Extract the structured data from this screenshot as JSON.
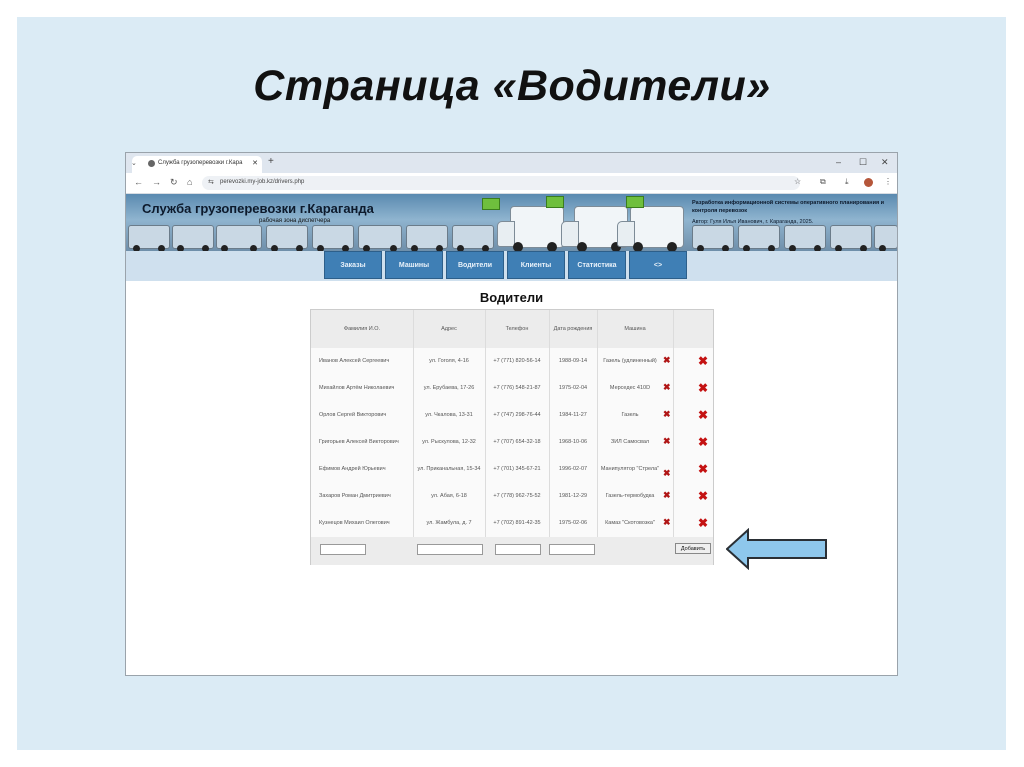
{
  "slide": {
    "title": "Страница «Водители»"
  },
  "browser": {
    "tab_title": "Служба грузоперевозки г.Кара",
    "url": "perevozki.my-job.kz/drivers.php"
  },
  "header": {
    "site_title": "Служба грузоперевозки г.Караганда",
    "subtitle": "рабочая зона диспетчера",
    "dev_info": "Разработка информационной системы оперативного планирования и контроля перевозок",
    "author": "Автор: Гуля Илья Иванович, г. Караганда, 2025."
  },
  "nav": {
    "items": [
      "Заказы",
      "Машины",
      "Водители",
      "Клиенты",
      "Статистика",
      "<>"
    ]
  },
  "page": {
    "heading": "Водители"
  },
  "table": {
    "headers": [
      "Фамилия И.О.",
      "Адрес",
      "Телефон",
      "Дата рождения",
      "Машина"
    ],
    "rows": [
      {
        "name": "Иванов Алексей Сергеевич",
        "address": "ул. Гоголя, 4-16",
        "phone": "+7 (771) 820-56-14",
        "birth": "1988-09-14",
        "car": "Газель (удлиненный)"
      },
      {
        "name": "Михайлов Артём Николаевич",
        "address": "ул. Ерубаева, 17-26",
        "phone": "+7 (776) 548-21-87",
        "birth": "1975-02-04",
        "car": "Мерседес 410D"
      },
      {
        "name": "Орлов Сергей Викторович",
        "address": "ул. Чкалова, 13-31",
        "phone": "+7 (747) 298-76-44",
        "birth": "1984-11-27",
        "car": "Газель"
      },
      {
        "name": "Григорьев Алексей Викторович",
        "address": "ул. Рыскулова, 12-32",
        "phone": "+7 (707) 654-32-18",
        "birth": "1968-10-06",
        "car": "ЗИЛ Самосвал"
      },
      {
        "name": "Ефимов Андрей Юрьевич",
        "address": "ул. Приканальная, 15-34",
        "phone": "+7 (701) 345-67-21",
        "birth": "1996-02-07",
        "car": "Манипулятор \"Стрела\""
      },
      {
        "name": "Захаров Роман Дмитриевич",
        "address": "ул. Абая, 6-18",
        "phone": "+7 (778) 962-75-52",
        "birth": "1981-12-29",
        "car": "Газель-термобудка"
      },
      {
        "name": "Кузнецов Михаил Олегович",
        "address": "ул. Жамбула, д. 7",
        "phone": "+7 (702) 891-42-35",
        "birth": "1975-02-06",
        "car": "Камаз \"Скотовозка\""
      }
    ],
    "add_label": "Добавить"
  }
}
